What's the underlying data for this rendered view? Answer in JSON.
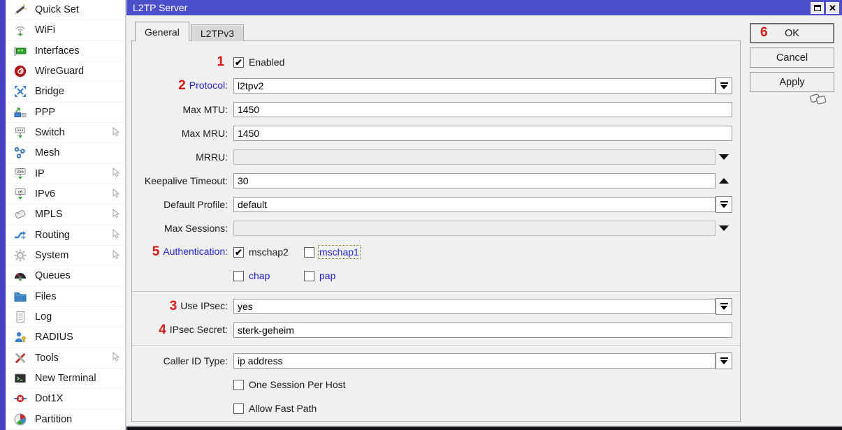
{
  "window": {
    "title": "L2TP Server",
    "controls": {
      "maximize": "maximize-icon",
      "close": "close-icon"
    }
  },
  "sidebar": {
    "items": [
      {
        "label": "Quick Set",
        "icon": "wand-icon",
        "has_arrow": false
      },
      {
        "label": "WiFi",
        "icon": "wifi-icon",
        "has_arrow": false
      },
      {
        "label": "Interfaces",
        "icon": "network-card-icon",
        "has_arrow": false
      },
      {
        "label": "WireGuard",
        "icon": "wireguard-icon",
        "has_arrow": false
      },
      {
        "label": "Bridge",
        "icon": "bridge-icon",
        "has_arrow": false
      },
      {
        "label": "PPP",
        "icon": "ppp-icon",
        "has_arrow": false
      },
      {
        "label": "Switch",
        "icon": "switch-icon",
        "has_arrow": true
      },
      {
        "label": "Mesh",
        "icon": "mesh-icon",
        "has_arrow": false
      },
      {
        "label": "IP",
        "icon": "ip-icon",
        "has_arrow": true
      },
      {
        "label": "IPv6",
        "icon": "ipv6-icon",
        "has_arrow": true
      },
      {
        "label": "MPLS",
        "icon": "mpls-icon",
        "has_arrow": true
      },
      {
        "label": "Routing",
        "icon": "routing-icon",
        "has_arrow": true
      },
      {
        "label": "System",
        "icon": "system-icon",
        "has_arrow": true
      },
      {
        "label": "Queues",
        "icon": "queues-icon",
        "has_arrow": false
      },
      {
        "label": "Files",
        "icon": "files-icon",
        "has_arrow": false
      },
      {
        "label": "Log",
        "icon": "log-icon",
        "has_arrow": false
      },
      {
        "label": "RADIUS",
        "icon": "radius-icon",
        "has_arrow": false
      },
      {
        "label": "Tools",
        "icon": "tools-icon",
        "has_arrow": true
      },
      {
        "label": "New Terminal",
        "icon": "terminal-icon",
        "has_arrow": false
      },
      {
        "label": "Dot1X",
        "icon": "dot1x-icon",
        "has_arrow": false
      },
      {
        "label": "Partition",
        "icon": "partition-icon",
        "has_arrow": false
      }
    ]
  },
  "tabs": [
    {
      "label": "General",
      "active": true
    },
    {
      "label": "L2TPv3",
      "active": false
    }
  ],
  "form": {
    "enabled_row": {
      "annotation": "1",
      "label": "Enabled",
      "checked": true,
      "mark": "✔"
    },
    "fields": [
      {
        "annotation": "2",
        "label": "Protocol:",
        "value": "l2tpv2",
        "label_color": "blue",
        "control": "dropdown"
      },
      {
        "label": "Max MTU:",
        "value": "1450",
        "control": "text"
      },
      {
        "label": "Max MRU:",
        "value": "1450",
        "control": "text"
      },
      {
        "label": "MRRU:",
        "value": "",
        "control": "disabled-spin-down"
      },
      {
        "label": "Keepalive Timeout:",
        "value": "30",
        "control": "spin-up"
      },
      {
        "label": "Default Profile:",
        "value": "default",
        "control": "dropdown"
      },
      {
        "label": "Max Sessions:",
        "value": "",
        "control": "disabled-spin-down"
      },
      {
        "annotation": "3",
        "label": "Use IPsec:",
        "value": "yes",
        "control": "dropdown"
      },
      {
        "annotation": "4",
        "label": "IPsec Secret:",
        "value": "sterk-geheim",
        "control": "text"
      },
      {
        "label": "Caller ID Type:",
        "value": "ip address",
        "control": "dropdown"
      }
    ],
    "authentication": {
      "annotation": "5",
      "label": "Authentication:",
      "options": [
        {
          "label": "mschap2",
          "checked": true,
          "mark": "✔",
          "label_color": "black",
          "focused": false
        },
        {
          "label": "mschap1",
          "checked": false,
          "mark": "",
          "label_color": "blue",
          "focused": true
        },
        {
          "label": "chap",
          "checked": false,
          "mark": "",
          "label_color": "blue",
          "focused": false
        },
        {
          "label": "pap",
          "checked": false,
          "mark": "",
          "label_color": "blue",
          "focused": false
        }
      ]
    },
    "extra_checkboxes": [
      {
        "label": "One Session Per Host",
        "checked": false,
        "mark": ""
      },
      {
        "label": "Allow Fast Path",
        "checked": false,
        "mark": ""
      }
    ]
  },
  "buttons": [
    {
      "annotation": "6",
      "label": "OK",
      "default": true
    },
    {
      "label": "Cancel"
    },
    {
      "label": "Apply"
    }
  ],
  "colors": {
    "titlebar": "#4c4fca",
    "edge_strip": "#453fc6",
    "annotation_red": "#d81616",
    "label_blue": "#2222cf"
  }
}
